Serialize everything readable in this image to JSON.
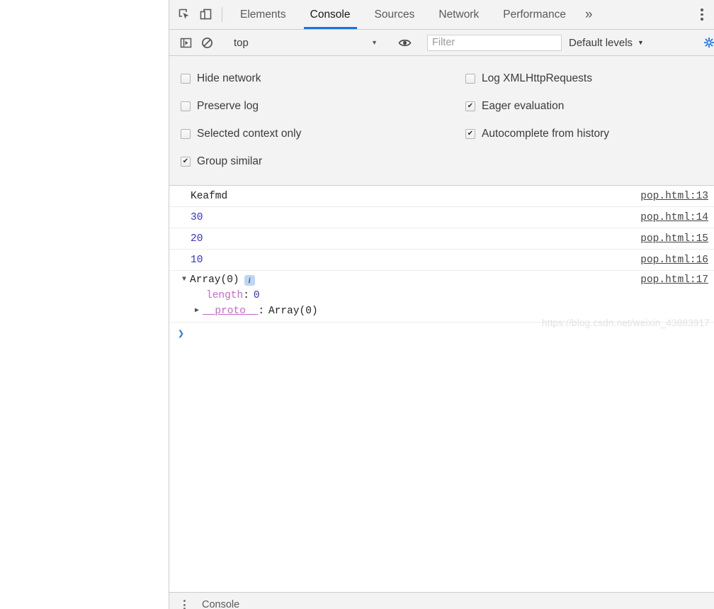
{
  "window": {
    "panel_name": "DevTools"
  },
  "tabstrip": {
    "inspect_icon": "inspect-cursor-icon",
    "device_icon": "device-toolbar-icon",
    "tabs": [
      {
        "label": "Elements",
        "active": false
      },
      {
        "label": "Console",
        "active": true
      },
      {
        "label": "Sources",
        "active": false
      },
      {
        "label": "Network",
        "active": false
      },
      {
        "label": "Performance",
        "active": false
      }
    ],
    "more_label": "»",
    "kebab_icon": "more-options-icon"
  },
  "console_toolbar": {
    "sidebar_toggle_icon": "console-sidebar-icon",
    "clear_icon": "clear-console-icon",
    "context": {
      "value": "top",
      "caret": "▼"
    },
    "eye_icon": "live-expression-eye-icon",
    "filter": {
      "value": "",
      "placeholder": "Filter"
    },
    "levels": {
      "label": "Default levels",
      "caret": "▼"
    },
    "settings_icon": "settings-gear-icon"
  },
  "settings_pane": {
    "options": [
      {
        "label": "Hide network",
        "checked": false
      },
      {
        "label": "Log XMLHttpRequests",
        "checked": false
      },
      {
        "label": "Preserve log",
        "checked": false
      },
      {
        "label": "Eager evaluation",
        "checked": true
      },
      {
        "label": "Selected context only",
        "checked": false
      },
      {
        "label": "Autocomplete from history",
        "checked": true
      },
      {
        "label": "Group similar",
        "checked": true
      },
      {
        "label": "",
        "checked": null
      }
    ]
  },
  "console_messages": [
    {
      "text": "Keafmd",
      "kind": "string",
      "source": "pop.html:13"
    },
    {
      "text": "30",
      "kind": "number",
      "source": "pop.html:14"
    },
    {
      "text": "20",
      "kind": "number",
      "source": "pop.html:15"
    },
    {
      "text": "10",
      "kind": "number",
      "source": "pop.html:16"
    }
  ],
  "expanded_object": {
    "triangle": "▼",
    "name": "Array(0)",
    "info_badge": "i",
    "source": "pop.html:17",
    "properties": [
      {
        "triangle": "",
        "key": "length",
        "underline": false,
        "colon": ":",
        "value": "0",
        "value_kind": "number"
      },
      {
        "triangle": "▶",
        "key": "__proto__",
        "underline": true,
        "colon": ":",
        "value": "Array(0)",
        "value_kind": "plain"
      }
    ]
  },
  "prompt": {
    "caret": "❯"
  },
  "drawer": {
    "kebab_icon": "drawer-more-options-icon",
    "tab_label": "Console"
  },
  "watermark": {
    "text": "https://blog.csdn.net/weixin_43883917"
  },
  "colors": {
    "accent": "#1a73e8",
    "toolbar_bg": "#f3f3f3",
    "border": "#cdcdcd",
    "number": "#3232c8",
    "property_key": "#c46ac4",
    "info_badge": "#bdd6f7"
  }
}
